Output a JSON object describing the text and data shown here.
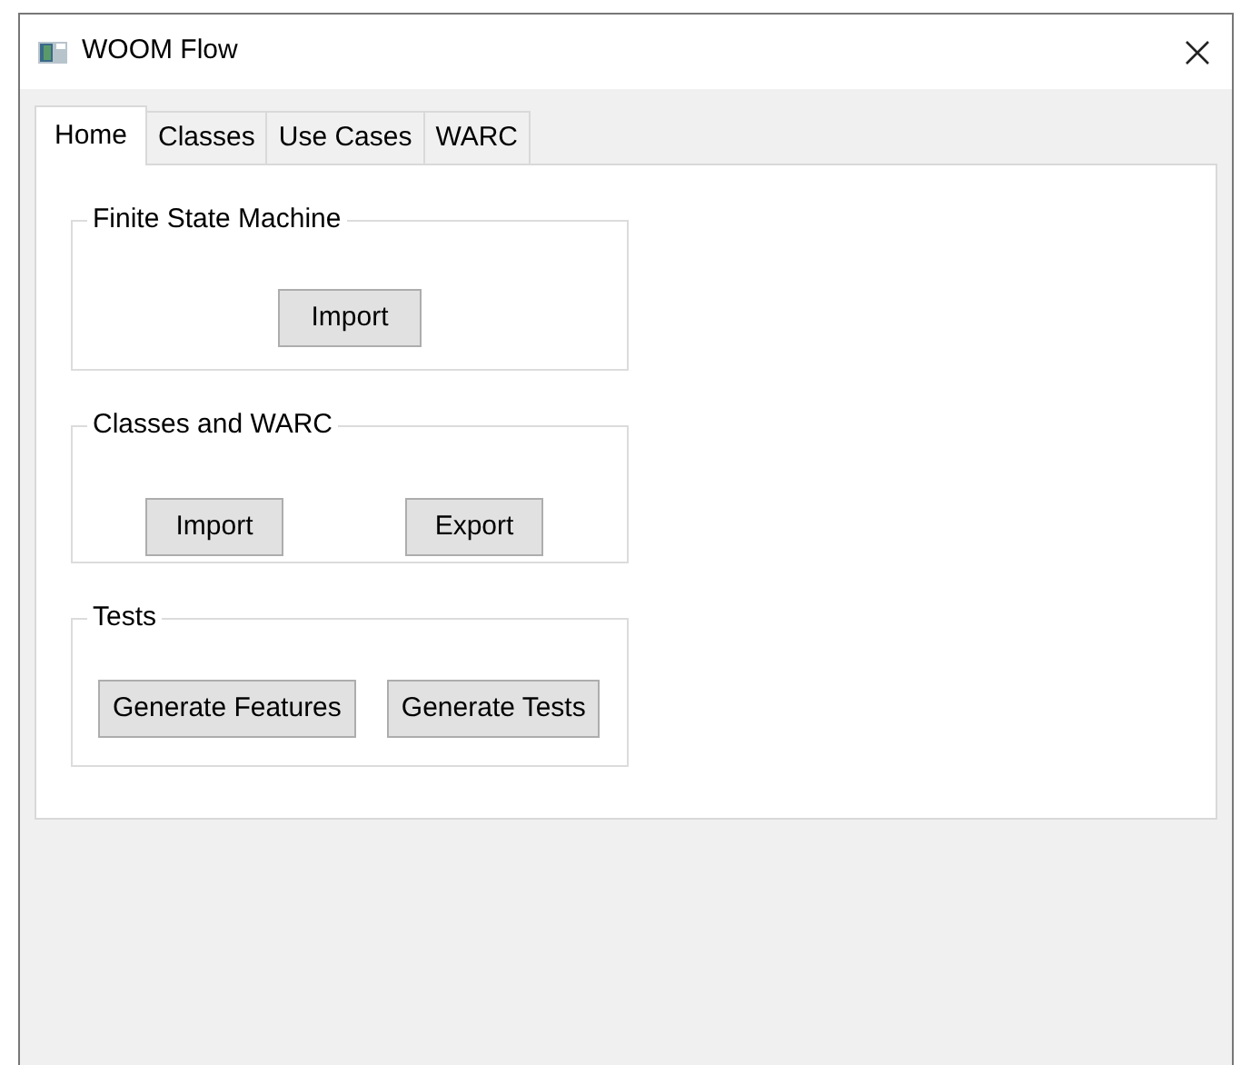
{
  "window": {
    "title": "WOOM Flow"
  },
  "tabs": [
    {
      "label": "Home",
      "selected": true
    },
    {
      "label": "Classes",
      "selected": false
    },
    {
      "label": "Use Cases",
      "selected": false
    },
    {
      "label": "WARC",
      "selected": false
    }
  ],
  "groups": [
    {
      "title": "Finite State Machine",
      "kind": "center",
      "buttons": [
        "Import"
      ]
    },
    {
      "title": "Classes and WARC",
      "kind": "spread",
      "buttons": [
        "Import",
        "Export"
      ]
    },
    {
      "title": "Tests",
      "kind": "tight",
      "buttons": [
        "Generate Features",
        "Generate Tests"
      ]
    }
  ]
}
